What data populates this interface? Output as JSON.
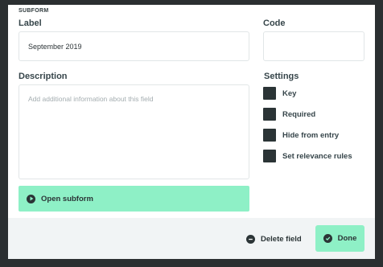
{
  "section_title": "SUBFORM",
  "label_field": {
    "label": "Label",
    "value": "September 2019"
  },
  "code_field": {
    "label": "Code",
    "value": ""
  },
  "description_field": {
    "label": "Description",
    "placeholder": "Add additional information about this field"
  },
  "settings": {
    "title": "Settings",
    "items": [
      {
        "label": "Key",
        "checked": false
      },
      {
        "label": "Required",
        "checked": false
      },
      {
        "label": "Hide from entry",
        "checked": false
      },
      {
        "label": "Set relevance rules",
        "checked": false
      }
    ]
  },
  "open_subform_label": "Open subform",
  "footer": {
    "delete_label": "Delete field",
    "done_label": "Done"
  },
  "colors": {
    "accent": "#8ef0c6",
    "dark": "#2b3436",
    "backdrop": "#2b2f31"
  },
  "icons": {
    "open_subform": "play-circle-icon",
    "delete": "minus-circle-icon",
    "done": "check-circle-icon"
  }
}
